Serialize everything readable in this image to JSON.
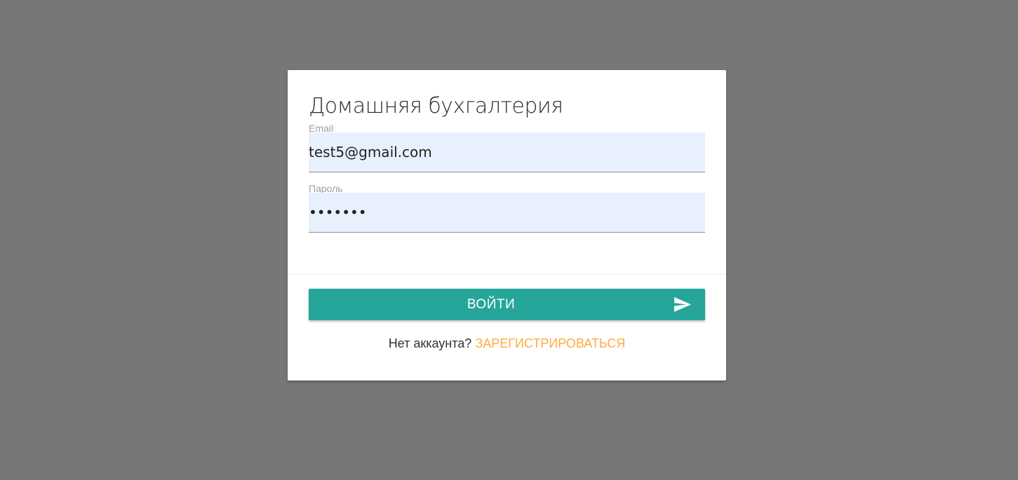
{
  "login_form": {
    "title": "Домашняя бухгалтерия",
    "email": {
      "label": "Email",
      "value": "test5@gmail.com"
    },
    "password": {
      "label": "Пароль",
      "value": "•••••••"
    },
    "submit_label": "ВОЙТИ",
    "submit_icon": "send-icon",
    "register_prompt": "Нет аккаунта?",
    "register_link": "ЗАРЕГИСТРИРОВАТЬСЯ"
  },
  "colors": {
    "background": "#777777",
    "card": "#ffffff",
    "input_autofill": "#e8f0fe",
    "primary_button": "#26a69a",
    "link": "#ffab40"
  }
}
